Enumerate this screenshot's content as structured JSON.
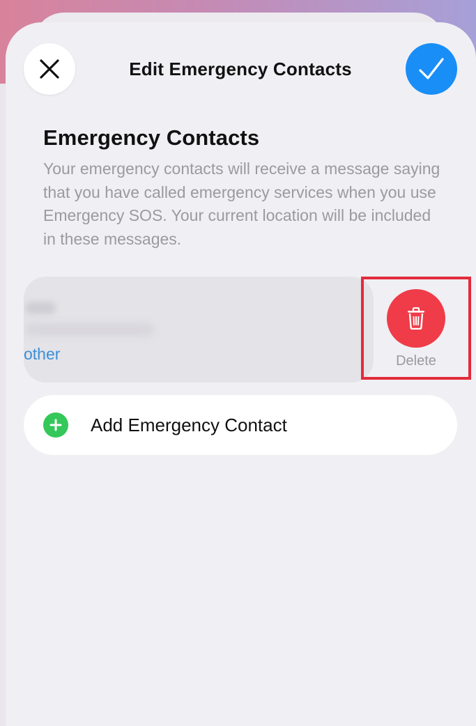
{
  "header": {
    "title": "Edit Emergency Contacts",
    "close_icon": "close-icon",
    "done_icon": "checkmark-icon"
  },
  "section": {
    "title": "Emergency Contacts",
    "description": "Your emergency contacts will receive a message saying that you have called emergency services when you use Emergency SOS. Your current location will be included in these messages."
  },
  "contact": {
    "relationship": "other"
  },
  "swipe_action": {
    "label": "Delete",
    "icon": "trash-icon"
  },
  "add_contact": {
    "label": "Add Emergency Contact",
    "icon": "plus-circle-icon"
  },
  "colors": {
    "accent_blue": "#1a8ef7",
    "delete_red": "#f03c48",
    "add_green": "#34c759",
    "highlight_red": "#e32c3b",
    "link_blue": "#3b8fd8"
  }
}
